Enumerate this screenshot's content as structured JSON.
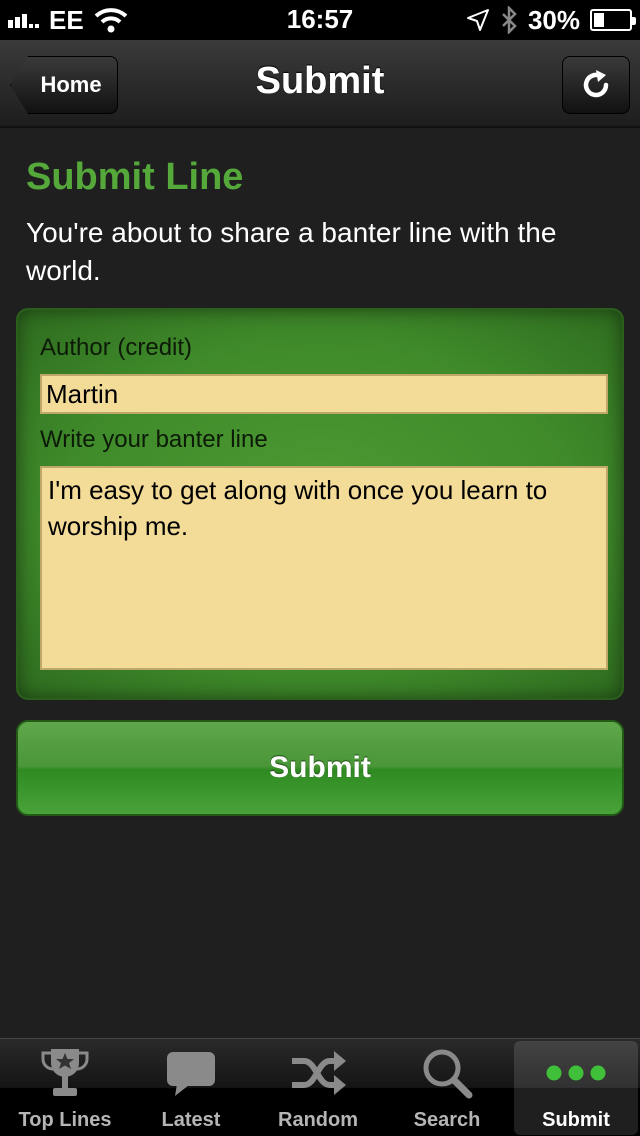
{
  "status_bar": {
    "carrier": "EE",
    "time": "16:57",
    "battery": "30%",
    "battery_level": 0.3,
    "icons": [
      "signal-icon",
      "wifi-icon",
      "location-icon",
      "bluetooth-icon",
      "battery-icon"
    ]
  },
  "nav": {
    "title": "Submit",
    "back_label": "Home",
    "refresh_icon": "refresh-icon"
  },
  "page": {
    "heading": "Submit Line",
    "intro": "You're about to share a banter line with the world."
  },
  "form": {
    "author_label": "Author (credit)",
    "author_value": "Martin",
    "line_label": "Write your banter line",
    "line_value": "I'm easy to get along with once you learn to worship me.",
    "submit_label": "Submit"
  },
  "tabs": [
    {
      "label": "Top Lines",
      "icon": "trophy-icon",
      "active": false
    },
    {
      "label": "Latest",
      "icon": "speech-bubble-icon",
      "active": false
    },
    {
      "label": "Random",
      "icon": "shuffle-icon",
      "active": false
    },
    {
      "label": "Search",
      "icon": "search-icon",
      "active": false
    },
    {
      "label": "Submit",
      "icon": "more-dots-icon",
      "active": true
    }
  ],
  "colors": {
    "accent_green": "#55a93a",
    "input_bg": "#f3db98",
    "background": "#1f1f20"
  }
}
